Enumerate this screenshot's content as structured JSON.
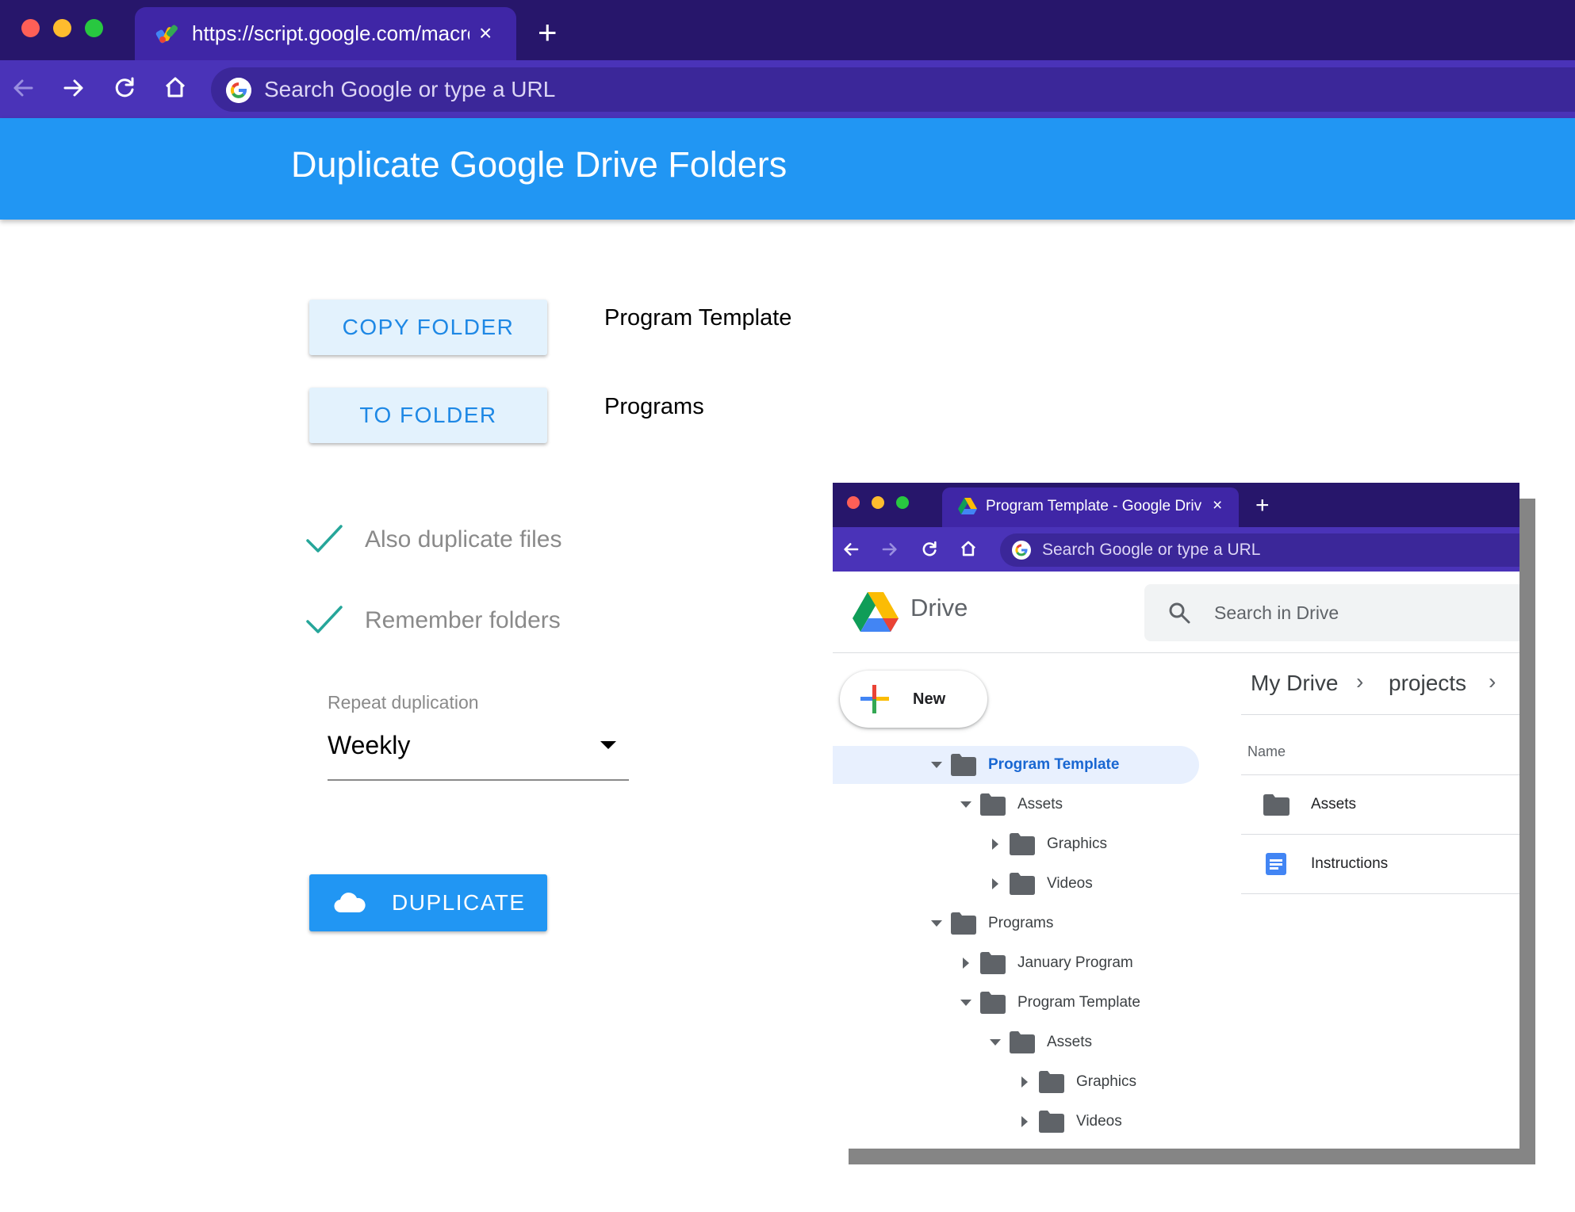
{
  "browser": {
    "tab_title": "https://script.google.com/macros",
    "tab_close": "×",
    "new_tab": "+",
    "omnibox_placeholder": "Search Google or type a URL",
    "colors": {
      "titlebar": "#27166b",
      "tab": "#3f26a6",
      "toolbar": "#4a33b8"
    }
  },
  "app": {
    "title": "Duplicate Google Drive Folders",
    "copy_folder_button": "COPY FOLDER",
    "copy_folder_value": "Program Template",
    "to_folder_button": "TO FOLDER",
    "to_folder_value": "Programs",
    "checkboxes": [
      {
        "label": "Also duplicate files",
        "checked": true
      },
      {
        "label": "Remember folders",
        "checked": true
      }
    ],
    "repeat_label": "Repeat duplication",
    "repeat_value": "Weekly",
    "duplicate_button": "DUPLICATE",
    "colors": {
      "header": "#2196f3",
      "light_button": "#e3f2fd",
      "check": "#26a69a"
    }
  },
  "drive_window": {
    "tab_title": "Program Template - Google Drive",
    "tab_close": "×",
    "new_tab": "+",
    "omnibox_placeholder": "Search Google or type a URL",
    "app_name": "Drive",
    "search_placeholder": "Search in Drive",
    "new_button": "New",
    "breadcrumb": [
      "My Drive",
      "projects"
    ],
    "breadcrumb_sep": "›",
    "name_header": "Name",
    "tree": [
      {
        "label": "Program Template",
        "expanded": true,
        "selected": true
      },
      {
        "label": "Assets",
        "expanded": true
      },
      {
        "label": "Graphics",
        "expanded": false
      },
      {
        "label": "Videos",
        "expanded": false
      },
      {
        "label": "Programs",
        "expanded": true
      },
      {
        "label": "January Program",
        "expanded": false
      },
      {
        "label": "Program Template",
        "expanded": true
      },
      {
        "label": "Assets",
        "expanded": true
      },
      {
        "label": "Graphics",
        "expanded": false
      },
      {
        "label": "Videos",
        "expanded": false
      }
    ],
    "files": [
      {
        "name": "Assets",
        "icon": "folder-icon"
      },
      {
        "name": "Instructions",
        "icon": "doc-icon"
      }
    ]
  }
}
